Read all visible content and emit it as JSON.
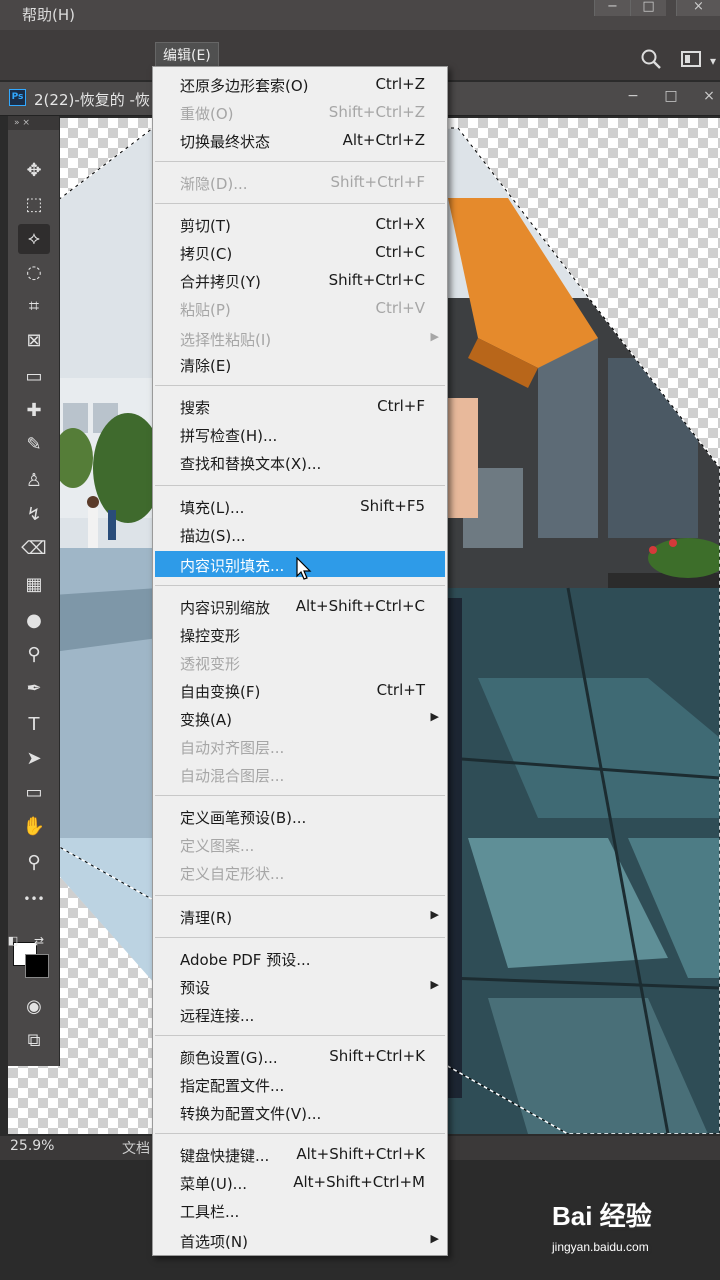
{
  "menubar": {
    "help": "帮助(H)"
  },
  "window_controls": [
    "−",
    "□",
    "×"
  ],
  "edit_menu_title": "编辑(E)",
  "options_icons": [
    "search-icon",
    "workspace-icon"
  ],
  "document": {
    "title": "2(22)-恢复的 -恢",
    "app_badge": "Ps"
  },
  "tools": [
    {
      "name": "move-tool-icon",
      "glyph": "✥"
    },
    {
      "name": "marquee-tool-icon",
      "glyph": "⬚"
    },
    {
      "name": "polygonal-lasso-tool-icon",
      "glyph": "⟡"
    },
    {
      "name": "quick-selection-tool-icon",
      "glyph": "◌"
    },
    {
      "name": "crop-tool-icon",
      "glyph": "⌗"
    },
    {
      "name": "frame-tool-icon",
      "glyph": "⊠"
    },
    {
      "name": "ruler-tool-icon",
      "glyph": "▭"
    },
    {
      "name": "healing-brush-tool-icon",
      "glyph": "✚"
    },
    {
      "name": "brush-tool-icon",
      "glyph": "✎"
    },
    {
      "name": "clone-stamp-tool-icon",
      "glyph": "♙"
    },
    {
      "name": "history-brush-tool-icon",
      "glyph": "↯"
    },
    {
      "name": "eraser-tool-icon",
      "glyph": "⌫"
    },
    {
      "name": "gradient-tool-icon",
      "glyph": "▦"
    },
    {
      "name": "blur-tool-icon",
      "glyph": "●"
    },
    {
      "name": "dodge-tool-icon",
      "glyph": "⚲"
    },
    {
      "name": "pen-tool-icon",
      "glyph": "✒"
    },
    {
      "name": "type-tool-icon",
      "glyph": "T"
    },
    {
      "name": "path-selection-tool-icon",
      "glyph": "➤"
    },
    {
      "name": "rectangle-tool-icon",
      "glyph": "▭"
    },
    {
      "name": "hand-tool-icon",
      "glyph": "✋"
    },
    {
      "name": "zoom-tool-icon",
      "glyph": "⚲"
    },
    {
      "name": "more-tools-icon",
      "glyph": "•••"
    }
  ],
  "status": {
    "zoom": "25.9%",
    "doc_label": "文档"
  },
  "menu": {
    "items": [
      {
        "label": "还原多边形套索(O)",
        "shortcut": "Ctrl+Z",
        "disabled": false,
        "submenu": false
      },
      {
        "label": "重做(O)",
        "shortcut": "Shift+Ctrl+Z",
        "disabled": true,
        "submenu": false
      },
      {
        "label": "切换最终状态",
        "shortcut": "Alt+Ctrl+Z",
        "disabled": false,
        "submenu": false
      },
      {
        "label": "渐隐(D)...",
        "shortcut": "Shift+Ctrl+F",
        "disabled": true,
        "submenu": false
      },
      {
        "label": "剪切(T)",
        "shortcut": "Ctrl+X",
        "disabled": false,
        "submenu": false
      },
      {
        "label": "拷贝(C)",
        "shortcut": "Ctrl+C",
        "disabled": false,
        "submenu": false
      },
      {
        "label": "合并拷贝(Y)",
        "shortcut": "Shift+Ctrl+C",
        "disabled": false,
        "submenu": false
      },
      {
        "label": "粘贴(P)",
        "shortcut": "Ctrl+V",
        "disabled": true,
        "submenu": false
      },
      {
        "label": "选择性粘贴(I)",
        "shortcut": "",
        "disabled": true,
        "submenu": true
      },
      {
        "label": "清除(E)",
        "shortcut": "",
        "disabled": false,
        "submenu": false
      },
      {
        "label": "搜索",
        "shortcut": "Ctrl+F",
        "disabled": false,
        "submenu": false
      },
      {
        "label": "拼写检查(H)...",
        "shortcut": "",
        "disabled": false,
        "submenu": false
      },
      {
        "label": "查找和替换文本(X)...",
        "shortcut": "",
        "disabled": false,
        "submenu": false
      },
      {
        "label": "填充(L)...",
        "shortcut": "Shift+F5",
        "disabled": false,
        "submenu": false
      },
      {
        "label": "描边(S)...",
        "shortcut": "",
        "disabled": false,
        "submenu": false
      },
      {
        "label": "内容识别填充...",
        "shortcut": "",
        "disabled": false,
        "submenu": false,
        "highlighted": true
      },
      {
        "label": "内容识别缩放",
        "shortcut": "Alt+Shift+Ctrl+C",
        "disabled": false,
        "submenu": false
      },
      {
        "label": "操控变形",
        "shortcut": "",
        "disabled": false,
        "submenu": false
      },
      {
        "label": "透视变形",
        "shortcut": "",
        "disabled": true,
        "submenu": false
      },
      {
        "label": "自由变换(F)",
        "shortcut": "Ctrl+T",
        "disabled": false,
        "submenu": false
      },
      {
        "label": "变换(A)",
        "shortcut": "",
        "disabled": false,
        "submenu": true
      },
      {
        "label": "自动对齐图层...",
        "shortcut": "",
        "disabled": true,
        "submenu": false
      },
      {
        "label": "自动混合图层...",
        "shortcut": "",
        "disabled": true,
        "submenu": false
      },
      {
        "label": "定义画笔预设(B)...",
        "shortcut": "",
        "disabled": false,
        "submenu": false
      },
      {
        "label": "定义图案...",
        "shortcut": "",
        "disabled": true,
        "submenu": false
      },
      {
        "label": "定义自定形状...",
        "shortcut": "",
        "disabled": true,
        "submenu": false
      },
      {
        "label": "清理(R)",
        "shortcut": "",
        "disabled": false,
        "submenu": true
      },
      {
        "label": "Adobe PDF 预设...",
        "shortcut": "",
        "disabled": false,
        "submenu": false
      },
      {
        "label": "预设",
        "shortcut": "",
        "disabled": false,
        "submenu": true
      },
      {
        "label": "远程连接...",
        "shortcut": "",
        "disabled": false,
        "submenu": false
      },
      {
        "label": "颜色设置(G)...",
        "shortcut": "Shift+Ctrl+K",
        "disabled": false,
        "submenu": false
      },
      {
        "label": "指定配置文件...",
        "shortcut": "",
        "disabled": false,
        "submenu": false
      },
      {
        "label": "转换为配置文件(V)...",
        "shortcut": "",
        "disabled": false,
        "submenu": false
      },
      {
        "label": "键盘快捷键...",
        "shortcut": "Alt+Shift+Ctrl+K",
        "disabled": false,
        "submenu": false
      },
      {
        "label": "菜单(U)...",
        "shortcut": "Alt+Shift+Ctrl+M",
        "disabled": false,
        "submenu": false
      },
      {
        "label": "工具栏...",
        "shortcut": "",
        "disabled": false,
        "submenu": false
      },
      {
        "label": "首选项(N)",
        "shortcut": "",
        "disabled": false,
        "submenu": true
      }
    ]
  },
  "watermark": {
    "logo": "Bai 经验",
    "url": "jingyan.baidu.com"
  },
  "colors": {
    "highlight": "#2e9be8",
    "menu_bg": "#efefef",
    "disabled_text": "#a6a6a6"
  }
}
